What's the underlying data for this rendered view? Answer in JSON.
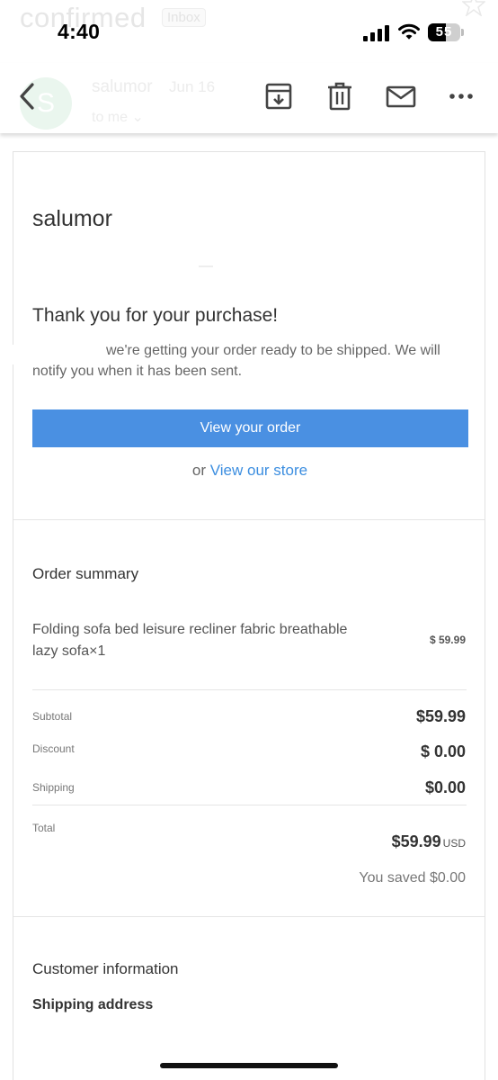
{
  "background_header": {
    "subject": "confirmed",
    "inbox_badge": "Inbox",
    "sender_initial": "S",
    "sender": "salumor",
    "date": "Jun 16",
    "recipient": "to me ⌄"
  },
  "status_bar": {
    "time": "4:40",
    "battery_percent": "55",
    "battery_level": 0.55
  },
  "toolbar": {
    "icons": [
      "back-arrow-icon",
      "archive-icon",
      "trash-icon",
      "mail-icon",
      "more-icon"
    ]
  },
  "email": {
    "shop_name": "salumor",
    "thanks_heading": "Thank you for your purchase!",
    "intro_text": "we're getting your order ready to be shipped. We will notify you when it has been sent.",
    "view_order_label": "View your order",
    "or_text": "or",
    "view_store_label": "View our store",
    "order_summary": {
      "heading": "Order summary",
      "item_title": "Folding sofa bed leisure recliner fabric breathable lazy sofa×1",
      "item_price": "$ 59.99",
      "subtotal_label": "Subtotal",
      "subtotal_value": "$59.99",
      "discount_label": "Discount",
      "discount_value": "$ 0.00",
      "shipping_label": "Shipping",
      "shipping_value": "$0.00",
      "total_label": "Total",
      "total_value": "$59.99",
      "total_currency": "USD",
      "saved_text": "You saved $0.00"
    },
    "customer_info_heading": "Customer information",
    "shipping_address_heading": "Shipping address"
  },
  "colors": {
    "accent_button": "#4a90e2",
    "link": "#3c8ee0"
  }
}
